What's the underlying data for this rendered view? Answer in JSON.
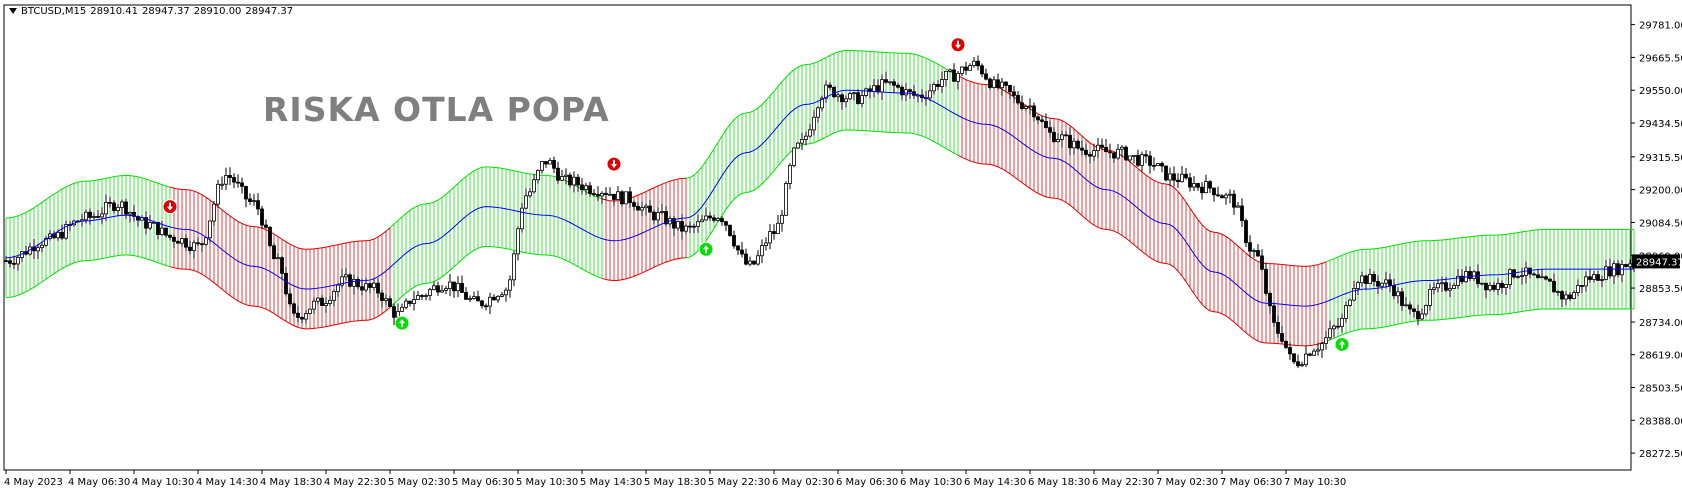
{
  "header": {
    "symbol": "BTCUSD,M15",
    "open": "28910.41",
    "high": "28947.37",
    "low": "28910.00",
    "close": "28947.37"
  },
  "watermark": "RISKA OTLA POPA",
  "colors": {
    "bull_band": "#00e000",
    "bear_band": "#e00000",
    "midline": "#0000ff",
    "candle": "#000000",
    "price_label_bg": "#000000",
    "arrow_up": "#00e000",
    "arrow_down": "#e00000"
  },
  "chart_data": {
    "type": "candlestick",
    "ylim": [
      28213,
      29850
    ],
    "yticks": [
      29781.0,
      29665.5,
      29550.0,
      29434.5,
      29315.5,
      29200.0,
      29084.5,
      28969.0,
      28853.5,
      28734.0,
      28619.0,
      28503.5,
      28388.0,
      28272.5
    ],
    "ytick_labels": [
      "29781.00",
      "29665.50",
      "29550.00",
      "29434.50",
      "29315.50",
      "29200.00",
      "29084.50",
      "28969.00",
      "28853.50",
      "28734.00",
      "28619.00",
      "28503.50",
      "28388.00",
      "28272.50"
    ],
    "current_price": 28947.37,
    "current_price_label": "28947.37",
    "xtick_labels": [
      "4 May 2023",
      "4 May 06:30",
      "4 May 10:30",
      "4 May 14:30",
      "4 May 18:30",
      "4 May 22:30",
      "5 May 02:30",
      "5 May 06:30",
      "5 May 10:30",
      "5 May 14:30",
      "5 May 18:30",
      "5 May 22:30",
      "6 May 02:30",
      "6 May 06:30",
      "6 May 10:30",
      "6 May 14:30",
      "6 May 18:30",
      "6 May 22:30",
      "7 May 02:30",
      "7 May 06:30",
      "7 May 10:30"
    ],
    "bars_per_xtick": 16,
    "midline_anchors": [
      [
        0,
        28960
      ],
      [
        20,
        29090
      ],
      [
        30,
        29110
      ],
      [
        45,
        29060
      ],
      [
        62,
        28930
      ],
      [
        75,
        28850
      ],
      [
        90,
        28880
      ],
      [
        105,
        29010
      ],
      [
        120,
        29140
      ],
      [
        135,
        29110
      ],
      [
        152,
        29020
      ],
      [
        170,
        29100
      ],
      [
        185,
        29330
      ],
      [
        200,
        29500
      ],
      [
        210,
        29550
      ],
      [
        225,
        29540
      ],
      [
        245,
        29430
      ],
      [
        262,
        29310
      ],
      [
        275,
        29200
      ],
      [
        290,
        29080
      ],
      [
        302,
        28910
      ],
      [
        315,
        28800
      ],
      [
        325,
        28790
      ],
      [
        340,
        28850
      ],
      [
        355,
        28880
      ],
      [
        372,
        28900
      ],
      [
        385,
        28920
      ]
    ],
    "band_halfwidth": 140,
    "band_trend_segments": [
      {
        "from": 0,
        "to": 42,
        "trend": "up"
      },
      {
        "from": 42,
        "to": 97,
        "trend": "down"
      },
      {
        "from": 97,
        "to": 150,
        "trend": "up"
      },
      {
        "from": 150,
        "to": 171,
        "trend": "down"
      },
      {
        "from": 171,
        "to": 239,
        "trend": "up"
      },
      {
        "from": 239,
        "to": 331,
        "trend": "down"
      },
      {
        "from": 331,
        "to": 407,
        "trend": "up"
      }
    ],
    "signal_arrows": [
      {
        "bar": 41,
        "direction": "down",
        "price": 29140
      },
      {
        "bar": 99,
        "direction": "up",
        "price": 28730
      },
      {
        "bar": 152,
        "direction": "down",
        "price": 29290
      },
      {
        "bar": 175,
        "direction": "up",
        "price": 28990
      },
      {
        "bar": 238,
        "direction": "down",
        "price": 29710
      },
      {
        "bar": 334,
        "direction": "up",
        "price": 28655
      }
    ],
    "price_anchors": [
      [
        0,
        28950
      ],
      [
        10,
        29020
      ],
      [
        20,
        29100
      ],
      [
        28,
        29150
      ],
      [
        35,
        29080
      ],
      [
        42,
        29030
      ],
      [
        48,
        29000
      ],
      [
        55,
        29250
      ],
      [
        62,
        29150
      ],
      [
        68,
        28940
      ],
      [
        72,
        28750
      ],
      [
        78,
        28800
      ],
      [
        85,
        28880
      ],
      [
        92,
        28850
      ],
      [
        98,
        28760
      ],
      [
        102,
        28820
      ],
      [
        110,
        28870
      ],
      [
        118,
        28800
      ],
      [
        125,
        28850
      ],
      [
        130,
        29180
      ],
      [
        135,
        29300
      ],
      [
        140,
        29230
      ],
      [
        148,
        29200
      ],
      [
        155,
        29170
      ],
      [
        162,
        29110
      ],
      [
        170,
        29060
      ],
      [
        178,
        29110
      ],
      [
        186,
        28930
      ],
      [
        192,
        29050
      ],
      [
        198,
        29350
      ],
      [
        205,
        29550
      ],
      [
        212,
        29520
      ],
      [
        220,
        29570
      ],
      [
        228,
        29530
      ],
      [
        236,
        29600
      ],
      [
        242,
        29640
      ],
      [
        248,
        29560
      ],
      [
        255,
        29500
      ],
      [
        262,
        29390
      ],
      [
        270,
        29340
      ],
      [
        278,
        29330
      ],
      [
        285,
        29300
      ],
      [
        292,
        29240
      ],
      [
        300,
        29210
      ],
      [
        306,
        29170
      ],
      [
        312,
        28980
      ],
      [
        318,
        28700
      ],
      [
        322,
        28590
      ],
      [
        328,
        28650
      ],
      [
        333,
        28720
      ],
      [
        338,
        28890
      ],
      [
        345,
        28870
      ],
      [
        352,
        28760
      ],
      [
        358,
        28850
      ],
      [
        365,
        28900
      ],
      [
        372,
        28860
      ],
      [
        378,
        28910
      ],
      [
        385,
        28870
      ],
      [
        390,
        28820
      ],
      [
        396,
        28890
      ],
      [
        402,
        28920
      ],
      [
        407,
        28947
      ]
    ]
  }
}
